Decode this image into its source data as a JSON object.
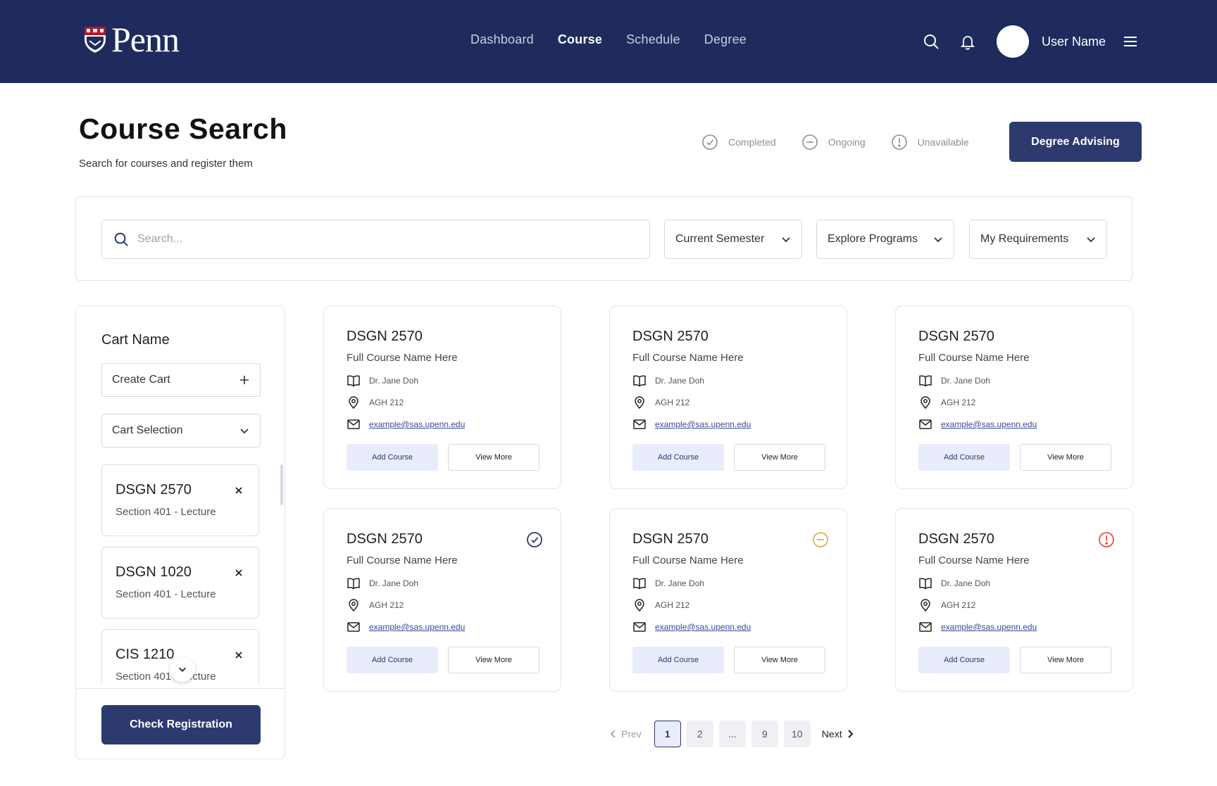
{
  "header": {
    "logo_text": "Penn",
    "nav": [
      {
        "label": "Dashboard",
        "active": false
      },
      {
        "label": "Course",
        "active": true
      },
      {
        "label": "Schedule",
        "active": false
      },
      {
        "label": "Degree",
        "active": false
      }
    ],
    "user_name": "User Name",
    "icons": [
      "search-icon",
      "bell-icon",
      "menu-icon"
    ]
  },
  "page": {
    "title": "Course Search",
    "subtitle": "Search for courses and register them",
    "legend": [
      {
        "label": "Completed",
        "icon": "check-circle-icon"
      },
      {
        "label": "Ongoing",
        "icon": "minus-circle-icon"
      },
      {
        "label": "Unavailable",
        "icon": "alert-circle-icon"
      }
    ],
    "advising_button": "Degree Advising"
  },
  "search": {
    "placeholder": "Search...",
    "filters": [
      "Current Semester",
      "Explore Programs",
      "My Requirements"
    ]
  },
  "cart": {
    "title": "Cart Name",
    "create_label": "Create Cart",
    "selection_label": "Cart Selection",
    "items": [
      {
        "code": "DSGN 2570",
        "section": "Section 401 - Lecture"
      },
      {
        "code": "DSGN 1020",
        "section": "Section 401 - Lecture"
      },
      {
        "code": "CIS 1210",
        "section": "Section 401 - Lecture"
      }
    ],
    "check_button": "Check Registration"
  },
  "courses": [
    {
      "code": "DSGN 2570",
      "name": "Full Course Name Here",
      "instructor": "Dr. Jane Doh",
      "room": "AGH 212",
      "email": "example@sas.upenn.edu",
      "add_label": "Add Course",
      "view_label": "View More",
      "status": ""
    },
    {
      "code": "DSGN 2570",
      "name": "Full Course Name Here",
      "instructor": "Dr. Jane Doh",
      "room": "AGH 212",
      "email": "example@sas.upenn.edu",
      "add_label": "Add Course",
      "view_label": "View More",
      "status": ""
    },
    {
      "code": "DSGN 2570",
      "name": "Full Course Name Here",
      "instructor": "Dr. Jane Doh",
      "room": "AGH 212",
      "email": "example@sas.upenn.edu",
      "add_label": "Add Course",
      "view_label": "View More",
      "status": ""
    },
    {
      "code": "DSGN 2570",
      "name": "Full Course Name Here",
      "instructor": "Dr. Jane Doh",
      "room": "AGH 212",
      "email": "example@sas.upenn.edu",
      "add_label": "Add Course",
      "view_label": "View More",
      "status": "completed"
    },
    {
      "code": "DSGN 2570",
      "name": "Full Course Name Here",
      "instructor": "Dr. Jane Doh",
      "room": "AGH 212",
      "email": "example@sas.upenn.edu",
      "add_label": "Add Course",
      "view_label": "View More",
      "status": "ongoing"
    },
    {
      "code": "DSGN 2570",
      "name": "Full Course Name Here",
      "instructor": "Dr. Jane Doh",
      "room": "AGH 212",
      "email": "example@sas.upenn.edu",
      "add_label": "Add Course",
      "view_label": "View More",
      "status": "unavailable"
    }
  ],
  "pagination": {
    "prev_label": "Prev",
    "next_label": "Next",
    "pages": [
      "1",
      "2",
      "...",
      "9",
      "10"
    ],
    "current": "1"
  },
  "colors": {
    "brand_navy": "#1f2b5c",
    "button_navy": "#2c3a70",
    "completed": "#2c3a70",
    "ongoing": "#e0b24a",
    "unavailable": "#e0533f"
  }
}
